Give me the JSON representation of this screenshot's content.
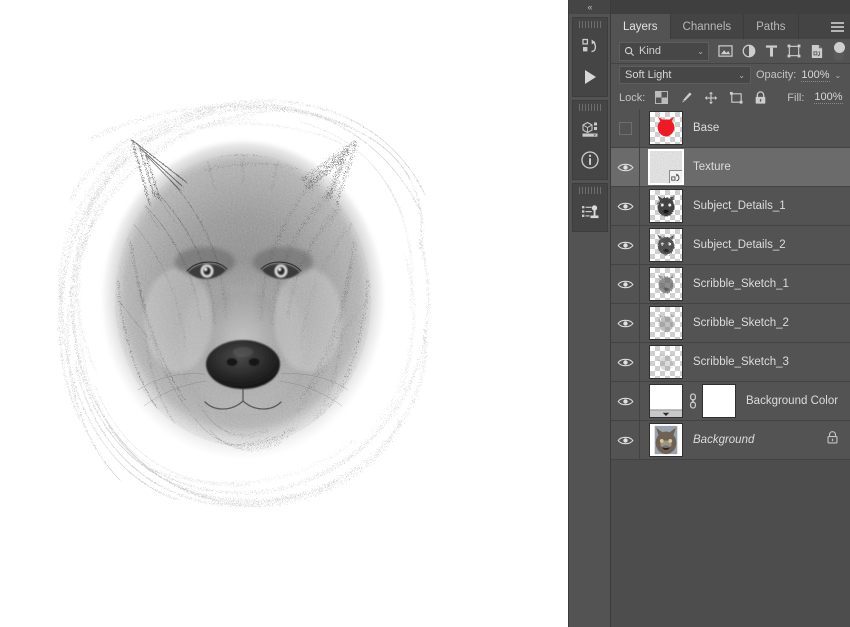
{
  "app": {
    "name": "Adobe Photoshop",
    "document_type": "sketch-composite"
  },
  "dock": {
    "collapse_label": "«",
    "buttons": [
      {
        "name": "actions-panel-icon",
        "title": "Actions"
      },
      {
        "name": "play-icon",
        "title": "Play"
      },
      {
        "name": "3d-panel-icon",
        "title": "3D"
      },
      {
        "name": "info-panel-icon",
        "title": "Info"
      },
      {
        "name": "properties-panel-icon",
        "title": "Properties"
      }
    ]
  },
  "panel": {
    "tabs": [
      {
        "label": "Layers",
        "active": true
      },
      {
        "label": "Channels",
        "active": false
      },
      {
        "label": "Paths",
        "active": false
      }
    ],
    "menu_icon": "hamburger-menu-icon",
    "filter": {
      "search_icon": "search-icon",
      "kind_label": "Kind",
      "chevron": "⌄",
      "icons": [
        "pixel-layer-filter-icon",
        "adjustment-layer-filter-icon",
        "type-layer-filter-icon",
        "shape-layer-filter-icon",
        "smart-object-filter-icon"
      ],
      "toggle": "filter-enable-toggle"
    },
    "blend": {
      "mode": "Soft Light",
      "chevron": "⌄",
      "opacity_label": "Opacity:",
      "opacity_value": "100%"
    },
    "lock": {
      "label": "Lock:",
      "icons": [
        "lock-transparent-pixels-icon",
        "lock-image-pixels-icon",
        "lock-position-icon",
        "lock-artboard-nesting-icon",
        "lock-all-icon"
      ],
      "fill_label": "Fill:",
      "fill_value": "100%"
    }
  },
  "layers": [
    {
      "name": "Base",
      "visible": false,
      "selected": false,
      "thumb": "red-wolf-silhouette",
      "smart_object": false,
      "locked": false,
      "italic": false
    },
    {
      "name": "Texture",
      "visible": true,
      "selected": true,
      "thumb": "grey-noise-texture",
      "smart_object": true,
      "locked": false,
      "italic": false
    },
    {
      "name": "Subject_Details_1",
      "visible": true,
      "selected": false,
      "thumb": "dark-sketch-wolf",
      "smart_object": false,
      "locked": false,
      "italic": false
    },
    {
      "name": "Subject_Details_2",
      "visible": true,
      "selected": false,
      "thumb": "dark-sketch-wolf",
      "smart_object": false,
      "locked": false,
      "italic": false
    },
    {
      "name": "Scribble_Sketch_1",
      "visible": true,
      "selected": false,
      "thumb": "mid-sketch-wolf",
      "smart_object": false,
      "locked": false,
      "italic": false
    },
    {
      "name": "Scribble_Sketch_2",
      "visible": true,
      "selected": false,
      "thumb": "light-sketch-wolf",
      "smart_object": false,
      "locked": false,
      "italic": false
    },
    {
      "name": "Scribble_Sketch_3",
      "visible": true,
      "selected": false,
      "thumb": "faint-sketch-wolf",
      "smart_object": false,
      "locked": false,
      "italic": false
    },
    {
      "name": "Background Color",
      "visible": true,
      "selected": false,
      "thumb": "white-gradient-fill",
      "mask_thumb": "white-layer-mask",
      "link_icon": "mask-link-icon",
      "smart_object": false,
      "locked": false,
      "italic": false
    },
    {
      "name": "Background",
      "visible": true,
      "selected": false,
      "thumb": "wolf-photo",
      "smart_object": false,
      "locked": true,
      "lock_icon": "lock-icon",
      "italic": true
    }
  ],
  "canvas": {
    "artwork_title": "Pencil sketch wolf portrait",
    "background_color": "#ffffff"
  },
  "colors": {
    "panel_bg": "#4d4d4d",
    "row_bg": "#535353",
    "row_selected": "#6b6b6b",
    "text": "#dcdcdc",
    "accent_red": "#e8202a"
  }
}
